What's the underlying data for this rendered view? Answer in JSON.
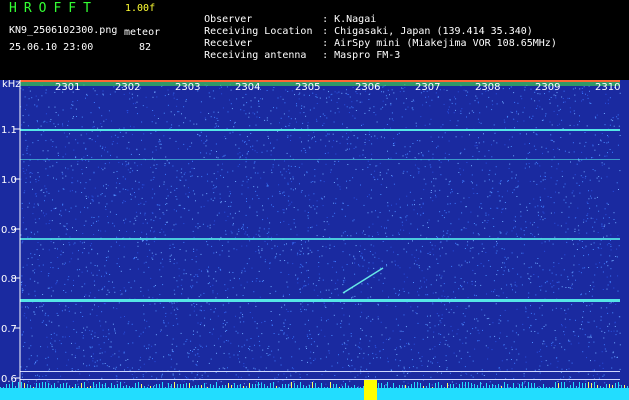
{
  "header": {
    "app_title": "HROFFT",
    "version": "1.00f",
    "filename": "KN9_2506102300.png",
    "meteor_label": "meteor",
    "datetime": "25.06.10 23:00",
    "meteor_count": "82"
  },
  "metadata": [
    {
      "key": "Observer",
      "value": "K.Nagai"
    },
    {
      "key": "Receiving Location",
      "value": "Chigasaki, Japan (139.414 35.340)"
    },
    {
      "key": "Receiver",
      "value": "AirSpy mini (Miakejima VOR 108.65MHz)"
    },
    {
      "key": "Receiving antenna",
      "value": "Maspro FM-3"
    }
  ],
  "waterfall": {
    "unit_label": "kHz",
    "time_labels": [
      "2301",
      "2302",
      "2303",
      "2304",
      "2305",
      "2306",
      "2307",
      "2308",
      "2309",
      "2310"
    ],
    "freq_labels": [
      "1.1",
      "1.0",
      "0.9",
      "0.8",
      "0.7",
      "0.6"
    ],
    "colors": {
      "background": "#1a2aa0",
      "noise": "#3c78ff",
      "signal": "#55e6e6",
      "baseline": "#22ddff",
      "burst": "#ffff00"
    }
  }
}
